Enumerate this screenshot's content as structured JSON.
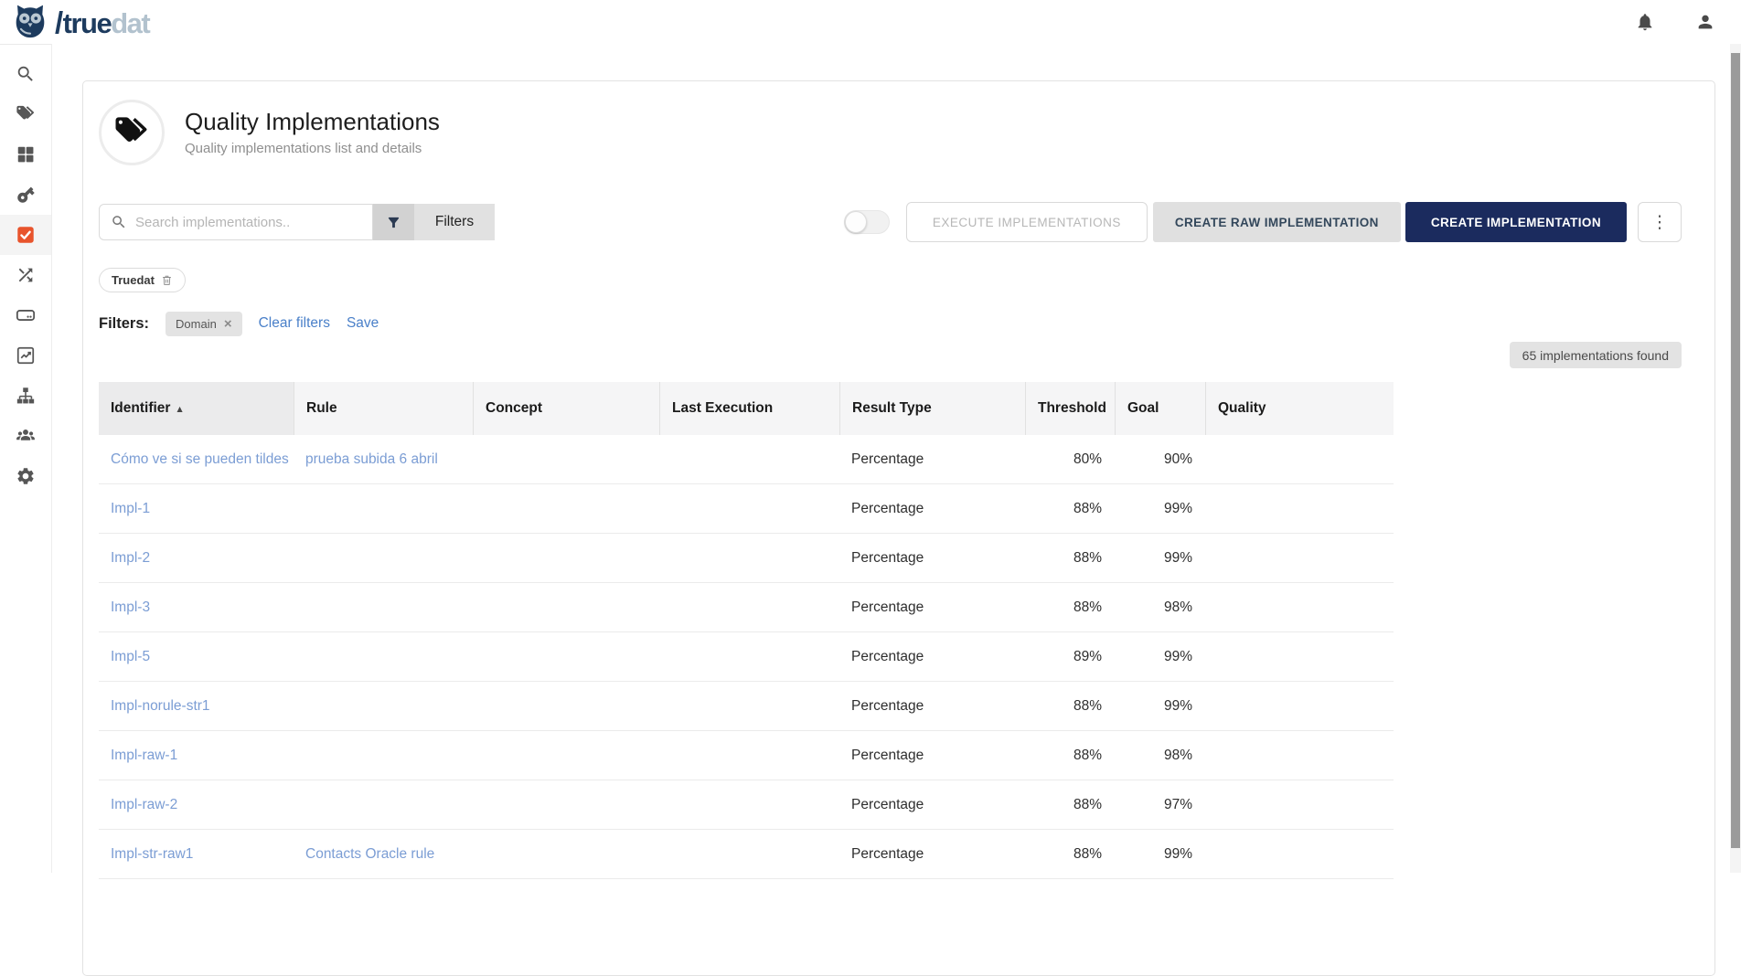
{
  "brand": {
    "slash": "/",
    "name_primary": "true",
    "name_secondary": "dat"
  },
  "sidebar": {
    "items": [
      {
        "icon": "search-icon",
        "active": false
      },
      {
        "icon": "tags-icon",
        "active": false
      },
      {
        "icon": "modules-grid-icon",
        "active": false
      },
      {
        "icon": "key-icon",
        "active": false
      },
      {
        "icon": "quality-check-icon",
        "active": true
      },
      {
        "icon": "shuffle-icon",
        "active": false
      },
      {
        "icon": "drive-icon",
        "active": false
      },
      {
        "icon": "chart-icon",
        "active": false
      },
      {
        "icon": "sitemap-icon",
        "active": false
      },
      {
        "icon": "users-icon",
        "active": false
      },
      {
        "icon": "gear-icon",
        "active": false
      }
    ]
  },
  "page": {
    "title": "Quality Implementations",
    "subtitle": "Quality implementations list and details",
    "search_placeholder": "Search implementations..",
    "filters_button": "Filters",
    "execute_button": "EXECUTE IMPLEMENTATIONS",
    "create_raw_button": "CREATE RAW IMPLEMENTATION",
    "create_button": "CREATE IMPLEMENTATION",
    "active_chip": "Truedat",
    "filters_label": "Filters:",
    "domain_chip": "Domain",
    "clear_filters_link": "Clear filters",
    "save_link": "Save",
    "results_badge": "65 implementations found"
  },
  "colors": {
    "brand_navy": "#1d3b5e",
    "brand_light": "#b2c2ce",
    "accent_navy_button": "#1b2b5e",
    "active_icon_orange": "#e8542c",
    "table_link_blue": "#7b9dd4",
    "action_link_blue": "#4a80c9"
  },
  "table": {
    "columns": [
      "Identifier",
      "Rule",
      "Concept",
      "Last Execution",
      "Result Type",
      "Threshold",
      "Goal",
      "Quality"
    ],
    "sorted_column": "Identifier",
    "sort_direction": "asc",
    "rows": [
      {
        "identifier": "Cómo ve si se pueden tildes",
        "rule": "prueba subida 6 abril",
        "concept": "",
        "last_execution": "",
        "result_type": "Percentage",
        "threshold": "80%",
        "goal": "90%",
        "quality": ""
      },
      {
        "identifier": "Impl-1",
        "rule": "",
        "concept": "",
        "last_execution": "",
        "result_type": "Percentage",
        "threshold": "88%",
        "goal": "99%",
        "quality": ""
      },
      {
        "identifier": "Impl-2",
        "rule": "",
        "concept": "",
        "last_execution": "",
        "result_type": "Percentage",
        "threshold": "88%",
        "goal": "99%",
        "quality": ""
      },
      {
        "identifier": "Impl-3",
        "rule": "",
        "concept": "",
        "last_execution": "",
        "result_type": "Percentage",
        "threshold": "88%",
        "goal": "98%",
        "quality": ""
      },
      {
        "identifier": "Impl-5",
        "rule": "",
        "concept": "",
        "last_execution": "",
        "result_type": "Percentage",
        "threshold": "89%",
        "goal": "99%",
        "quality": ""
      },
      {
        "identifier": "Impl-norule-str1",
        "rule": "",
        "concept": "",
        "last_execution": "",
        "result_type": "Percentage",
        "threshold": "88%",
        "goal": "99%",
        "quality": ""
      },
      {
        "identifier": "Impl-raw-1",
        "rule": "",
        "concept": "",
        "last_execution": "",
        "result_type": "Percentage",
        "threshold": "88%",
        "goal": "98%",
        "quality": ""
      },
      {
        "identifier": "Impl-raw-2",
        "rule": "",
        "concept": "",
        "last_execution": "",
        "result_type": "Percentage",
        "threshold": "88%",
        "goal": "97%",
        "quality": ""
      },
      {
        "identifier": "Impl-str-raw1",
        "rule": "Contacts Oracle rule",
        "concept": "",
        "last_execution": "",
        "result_type": "Percentage",
        "threshold": "88%",
        "goal": "99%",
        "quality": ""
      }
    ]
  }
}
